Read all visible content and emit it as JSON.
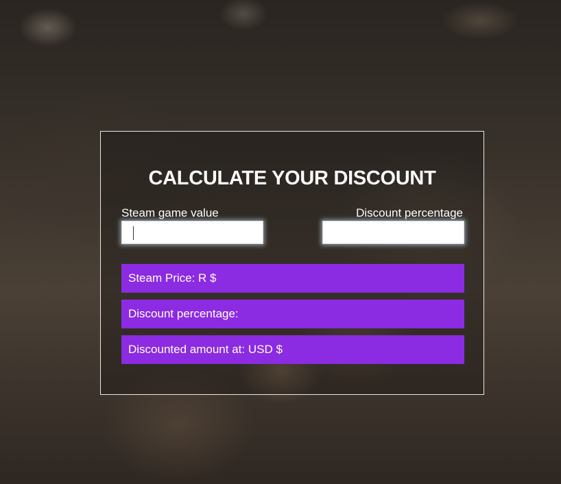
{
  "calculator": {
    "title": "CALCULATE YOUR DISCOUNT",
    "game_value_label": "Steam game value",
    "discount_label": "Discount percentage",
    "game_value_input": "",
    "discount_input": ""
  },
  "results": {
    "steam_price": "Steam Price: R $",
    "discount_percentage": "Discount percentage:",
    "discounted_amount": "Discounted amount at: USD $"
  },
  "colors": {
    "accent": "#8b2be2",
    "text": "#ffffff",
    "border": "#ffffff"
  }
}
